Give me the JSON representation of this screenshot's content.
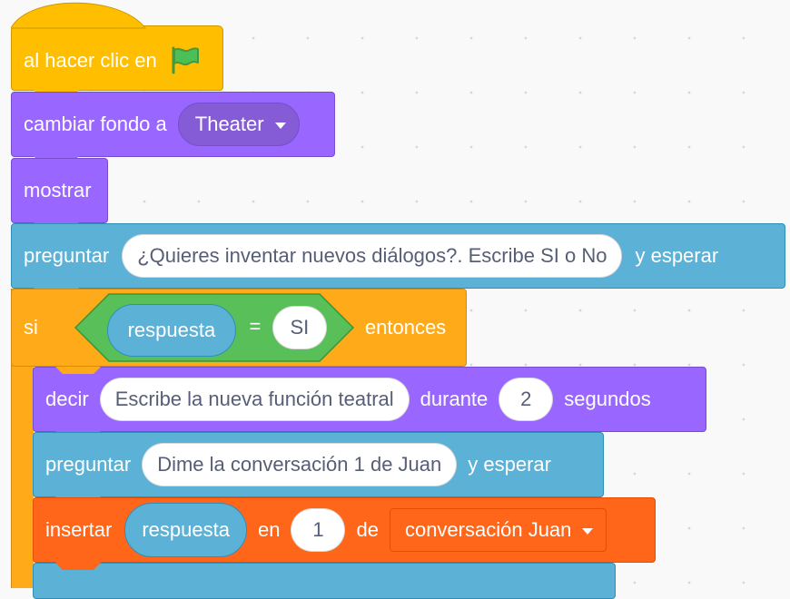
{
  "colors": {
    "events": "#ffbf00",
    "looks": "#9966ff",
    "sensing": "#5cb1d6",
    "control": "#ffab19",
    "operators": "#59c059",
    "lists": "#ff661a",
    "input_text": "#575e75"
  },
  "script": {
    "hat": {
      "label": "al hacer clic en",
      "icon": "green-flag-icon"
    },
    "switch_backdrop": {
      "label": "cambiar fondo a",
      "value": "Theater"
    },
    "show": {
      "label": "mostrar"
    },
    "ask1": {
      "label": "preguntar",
      "question": "¿Quieres inventar nuevos diálogos?. Escribe SI o No",
      "suffix": "y esperar"
    },
    "if": {
      "label": "si",
      "condition": {
        "left": "respuesta",
        "operator": "=",
        "right": "SI"
      },
      "suffix": "entonces"
    },
    "say": {
      "label": "decir",
      "message": "Escribe la nueva función teatral",
      "middle": "durante",
      "secs": "2",
      "suffix": "segundos"
    },
    "ask2": {
      "label": "preguntar",
      "question": "Dime la conversación 1 de Juan",
      "suffix": "y esperar"
    },
    "insert": {
      "label": "insertar",
      "item": "respuesta",
      "middle": "en",
      "index": "1",
      "of_label": "de",
      "list": "conversación Juan"
    }
  }
}
